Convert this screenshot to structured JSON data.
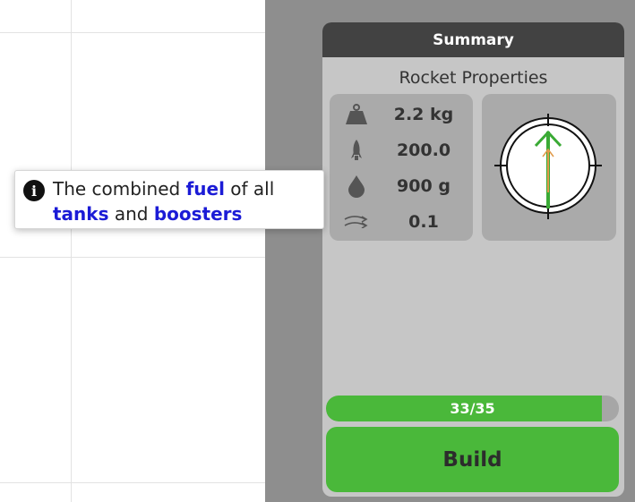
{
  "panel": {
    "title": "Summary",
    "subtitle": "Rocket Properties",
    "properties": [
      {
        "icon": "weight-icon",
        "value": "2.2 kg"
      },
      {
        "icon": "thrust-icon",
        "value": "200.0"
      },
      {
        "icon": "fuel-drop-icon",
        "value": "900 g"
      },
      {
        "icon": "drag-airflow-icon",
        "value": "0.1"
      }
    ],
    "progress": {
      "label": "33/35",
      "fraction": 0.943
    },
    "build_label": "Build"
  },
  "tooltip": {
    "parts_line1": [
      "The combined ",
      "fuel",
      " of all"
    ],
    "parts_line2": [
      "tanks",
      " and ",
      "boosters"
    ]
  },
  "colors": {
    "accent_green": "#4ab83a",
    "keyword_blue": "#1b1bd6",
    "header_dark": "#424242",
    "compass_orange": "#e09a4a"
  }
}
